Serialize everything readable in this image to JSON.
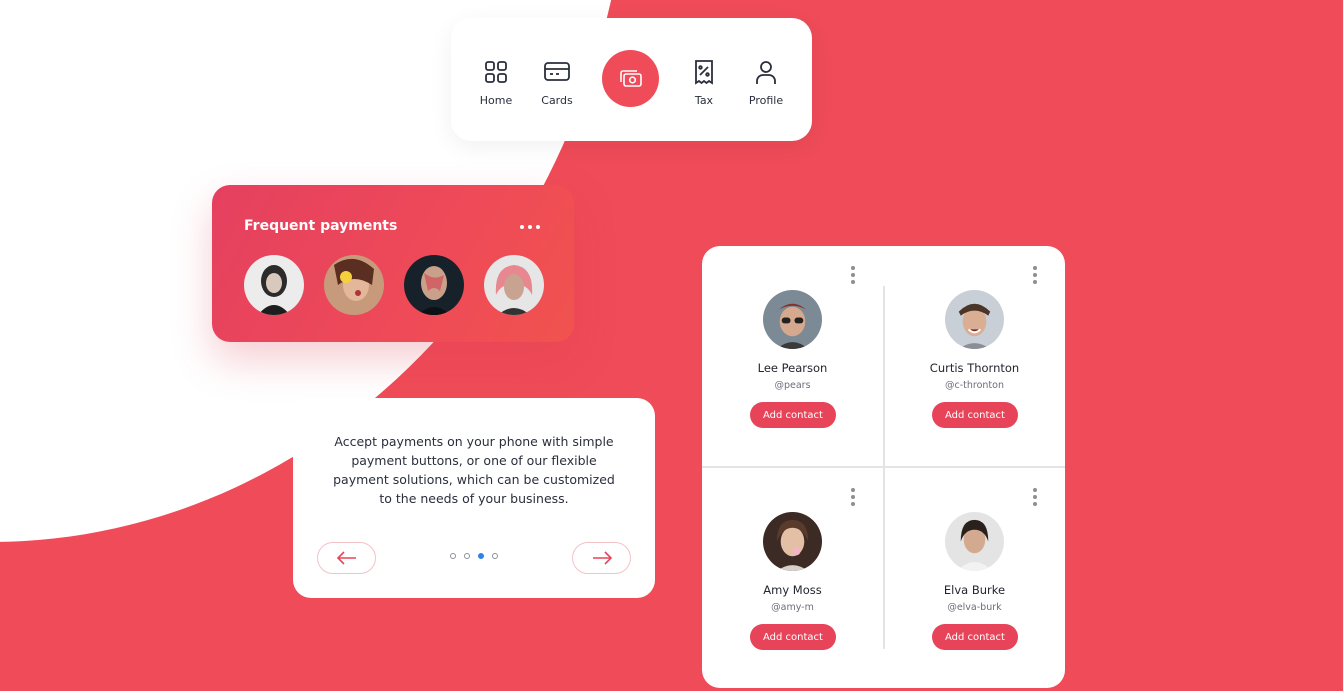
{
  "colors": {
    "brand": "#EF4B58",
    "accent_dot": "#2F80ED",
    "text": "#2A2F3C"
  },
  "nav": {
    "items": [
      {
        "label": "Home",
        "icon": "grid-icon"
      },
      {
        "label": "Cards",
        "icon": "credit-card-icon"
      },
      {
        "label": "",
        "icon": "money-stack-icon"
      },
      {
        "label": "Tax",
        "icon": "receipt-percent-icon"
      },
      {
        "label": "Profile",
        "icon": "user-icon"
      }
    ]
  },
  "frequent": {
    "title": "Frequent payments",
    "menu_icon": "more-horizontal-icon"
  },
  "info": {
    "text": "Accept payments on your phone with simple payment buttons, or one of our flexible payment solutions, which can be customized to the needs of your business.",
    "prev_icon": "arrow-left-icon",
    "next_icon": "arrow-right-icon",
    "page_count": 4,
    "active_page": 3
  },
  "contacts": [
    {
      "name": "Lee Pearson",
      "handle": "@pears",
      "button": "Add contact"
    },
    {
      "name": "Curtis Thornton",
      "handle": "@c-thronton",
      "button": "Add contact"
    },
    {
      "name": "Amy Moss",
      "handle": "@amy-m",
      "button": "Add contact"
    },
    {
      "name": "Elva Burke",
      "handle": "@elva-burk",
      "button": "Add contact"
    }
  ]
}
